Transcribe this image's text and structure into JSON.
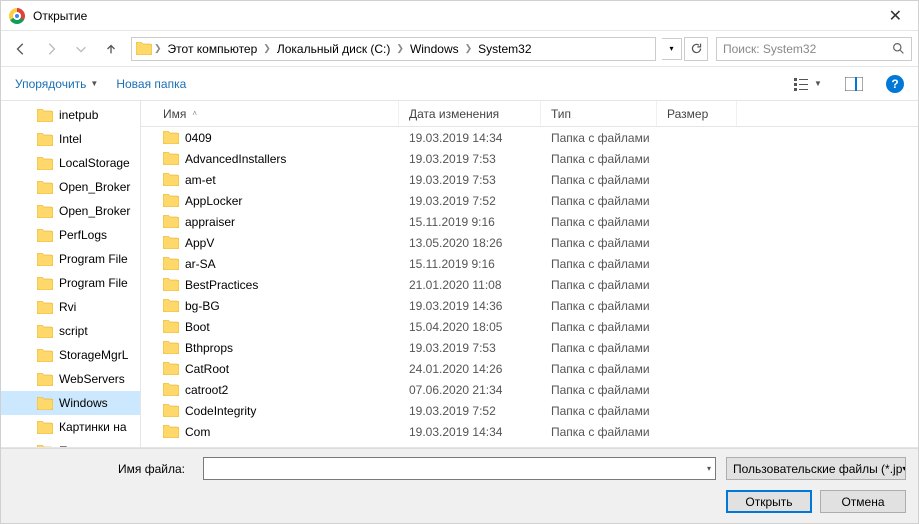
{
  "title": "Открытие",
  "breadcrumbs": [
    "Этот компьютер",
    "Локальный диск (C:)",
    "Windows",
    "System32"
  ],
  "search_placeholder": "Поиск: System32",
  "cmd_organize": "Упорядочить",
  "cmd_newfolder": "Новая папка",
  "columns": {
    "name": "Имя",
    "date": "Дата изменения",
    "type": "Тип",
    "size": "Размер"
  },
  "tree": [
    {
      "label": "inetpub"
    },
    {
      "label": "Intel"
    },
    {
      "label": "LocalStorage"
    },
    {
      "label": "Open_Broker"
    },
    {
      "label": "Open_Broker"
    },
    {
      "label": "PerfLogs"
    },
    {
      "label": "Program File"
    },
    {
      "label": "Program File"
    },
    {
      "label": "Rvi"
    },
    {
      "label": "script"
    },
    {
      "label": "StorageMgrL"
    },
    {
      "label": "WebServers"
    },
    {
      "label": "Windows",
      "selected": true
    },
    {
      "label": "Картинки на"
    },
    {
      "label": "Пользовател"
    }
  ],
  "files": [
    {
      "name": "0409",
      "date": "19.03.2019 14:34",
      "type": "Папка с файлами"
    },
    {
      "name": "AdvancedInstallers",
      "date": "19.03.2019 7:53",
      "type": "Папка с файлами"
    },
    {
      "name": "am-et",
      "date": "19.03.2019 7:53",
      "type": "Папка с файлами"
    },
    {
      "name": "AppLocker",
      "date": "19.03.2019 7:52",
      "type": "Папка с файлами"
    },
    {
      "name": "appraiser",
      "date": "15.11.2019 9:16",
      "type": "Папка с файлами"
    },
    {
      "name": "AppV",
      "date": "13.05.2020 18:26",
      "type": "Папка с файлами"
    },
    {
      "name": "ar-SA",
      "date": "15.11.2019 9:16",
      "type": "Папка с файлами"
    },
    {
      "name": "BestPractices",
      "date": "21.01.2020 11:08",
      "type": "Папка с файлами"
    },
    {
      "name": "bg-BG",
      "date": "19.03.2019 14:36",
      "type": "Папка с файлами"
    },
    {
      "name": "Boot",
      "date": "15.04.2020 18:05",
      "type": "Папка с файлами"
    },
    {
      "name": "Bthprops",
      "date": "19.03.2019 7:53",
      "type": "Папка с файлами"
    },
    {
      "name": "CatRoot",
      "date": "24.01.2020 14:26",
      "type": "Папка с файлами"
    },
    {
      "name": "catroot2",
      "date": "07.06.2020 21:34",
      "type": "Папка с файлами"
    },
    {
      "name": "CodeIntegrity",
      "date": "19.03.2019 7:52",
      "type": "Папка с файлами"
    },
    {
      "name": "Com",
      "date": "19.03.2019 14:34",
      "type": "Папка с файлами"
    }
  ],
  "filename_label": "Имя файла:",
  "filetype": "Пользовательские файлы (*.jp",
  "btn_open": "Открыть",
  "btn_cancel": "Отмена"
}
